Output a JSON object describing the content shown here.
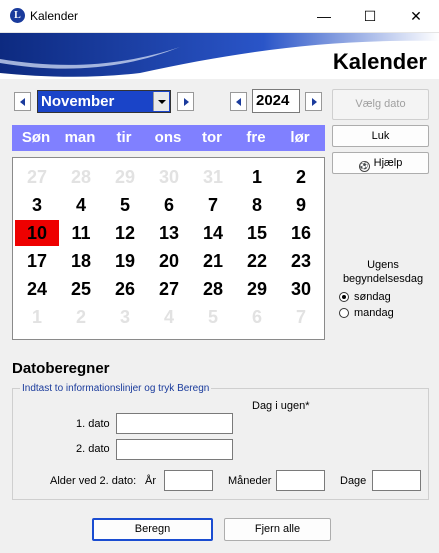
{
  "window": {
    "title": "Kalender",
    "controls": {
      "minimize": "—",
      "maximize": "☐",
      "close": "✕"
    }
  },
  "header": {
    "title": "Kalender"
  },
  "nav": {
    "month": "November",
    "year": "2024"
  },
  "buttons": {
    "choose_date": "Vælg dato",
    "close": "Luk",
    "help": "Hjælp",
    "calculate": "Beregn",
    "clear": "Fjern alle"
  },
  "weekdays": [
    "Søn",
    "man",
    "tir",
    "ons",
    "tor",
    "fre",
    "lør"
  ],
  "calendar": {
    "rows": [
      [
        "27",
        "28",
        "29",
        "30",
        "31",
        "1",
        "2"
      ],
      [
        "3",
        "4",
        "5",
        "6",
        "7",
        "8",
        "9"
      ],
      [
        "10",
        "11",
        "12",
        "13",
        "14",
        "15",
        "16"
      ],
      [
        "17",
        "18",
        "19",
        "20",
        "21",
        "22",
        "23"
      ],
      [
        "24",
        "25",
        "26",
        "27",
        "28",
        "29",
        "30"
      ],
      [
        "1",
        "2",
        "3",
        "4",
        "5",
        "6",
        "7"
      ]
    ],
    "today": "10"
  },
  "weekstart": {
    "label": "Ugens begyndelsesdag",
    "options": [
      {
        "label": "søndag",
        "selected": true
      },
      {
        "label": "mandag",
        "selected": false
      }
    ]
  },
  "calculator": {
    "title": "Datoberegner",
    "legend": "Indtast to informationslinjer og tryk Beregn",
    "weekday_header": "Dag i ugen*",
    "date1_label": "1. dato",
    "date2_label": "2. dato",
    "age_label": "Alder ved 2. dato:",
    "years_label": "År",
    "months_label": "Måneder",
    "days_label": "Dage"
  },
  "colors": {
    "weekday_bar": "#8080ff",
    "today": "#ee0000",
    "month_select": "#1a44c8",
    "header_wave": "#1a3b9c"
  }
}
